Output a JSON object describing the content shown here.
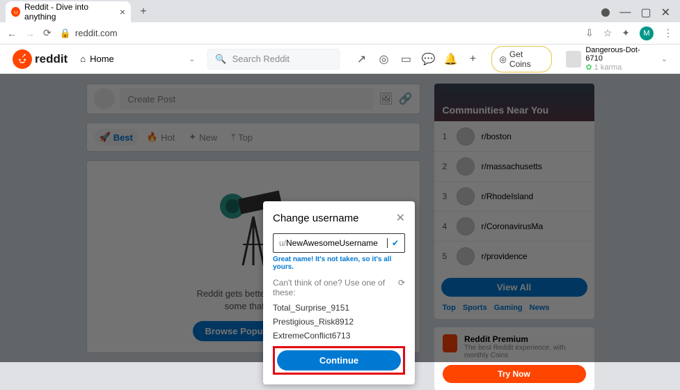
{
  "browser": {
    "tab_title": "Reddit - Dive into anything",
    "url": "reddit.com",
    "profile_initial": "M"
  },
  "header": {
    "brand": "reddit",
    "home_label": "Home",
    "search_placeholder": "Search Reddit",
    "coins_label": "Get Coins",
    "user": {
      "name": "Dangerous-Dot-6710",
      "karma": "1 karma"
    }
  },
  "main": {
    "create_post_placeholder": "Create Post",
    "sort": {
      "best": "Best",
      "hot": "Hot",
      "new": "New",
      "top": "Top"
    },
    "empty_headline_1": "Reddit gets better when you",
    "empty_headline_2": "some that you",
    "browse_btn": "Browse Popular Posts"
  },
  "sidebar": {
    "communities_title": "Communities Near You",
    "items": [
      {
        "rank": "1",
        "name": "r/boston"
      },
      {
        "rank": "2",
        "name": "r/massachusetts"
      },
      {
        "rank": "3",
        "name": "r/RhodeIsland"
      },
      {
        "rank": "4",
        "name": "r/CoronavirusMa"
      },
      {
        "rank": "5",
        "name": "r/providence"
      }
    ],
    "viewall": "View All",
    "topics": {
      "top": "Top",
      "sports": "Sports",
      "gaming": "Gaming",
      "news": "News"
    },
    "premium": {
      "title": "Reddit Premium",
      "desc": "The best Reddit experience, with monthly Coins",
      "btn": "Try Now"
    }
  },
  "modal": {
    "title": "Change username",
    "prefix": "u/",
    "value": "NewAwesomeUsername",
    "avail_msg": "Great name! It's not taken, so it's all yours.",
    "suggest_head": "Can't think of one? Use one of these:",
    "suggestions": [
      "Total_Surprise_9151",
      "Prestigious_Risk8912",
      "ExtremeConflict6713"
    ],
    "continue": "Continue"
  }
}
